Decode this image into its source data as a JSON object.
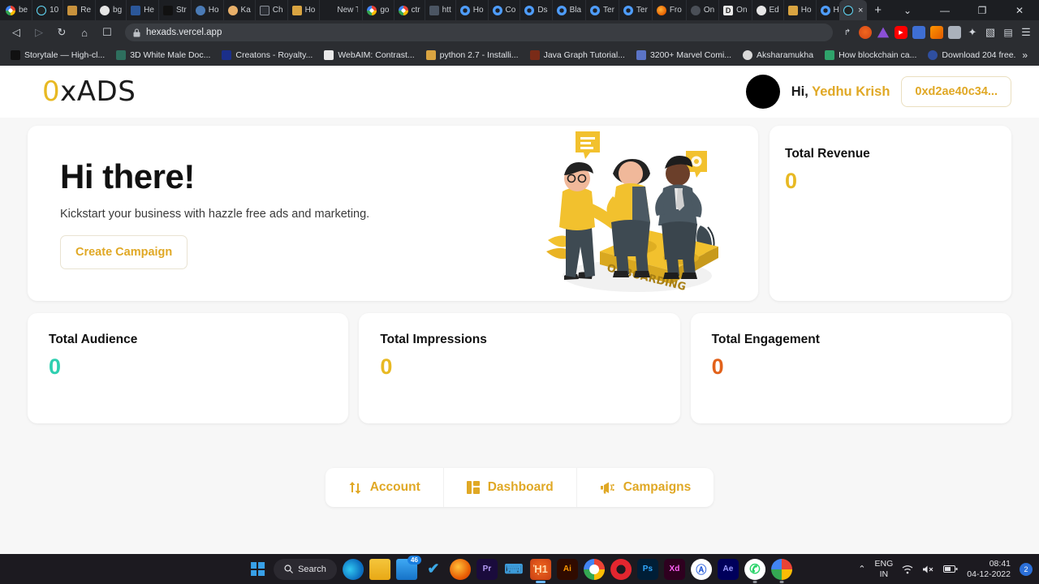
{
  "browser": {
    "tabs": [
      {
        "label": "be",
        "icon": "google-favicon",
        "fav": "g"
      },
      {
        "label": "10",
        "icon": "react-favicon",
        "fav": "react"
      },
      {
        "label": "Re",
        "icon": "book-favicon",
        "fav": "book"
      },
      {
        "label": "bg",
        "icon": "github-favicon",
        "fav": "gh"
      },
      {
        "label": "He",
        "icon": "word-favicon",
        "fav": "word"
      },
      {
        "label": "Str",
        "icon": "medium-favicon",
        "fav": "medium"
      },
      {
        "label": "Ho",
        "icon": "globe-favicon",
        "fav": "globe"
      },
      {
        "label": "Ka",
        "icon": "avatar-favicon",
        "fav": "ka"
      },
      {
        "label": "Ch",
        "icon": "box-favicon",
        "fav": "box"
      },
      {
        "label": "Ho",
        "icon": "java-favicon",
        "fav": "java"
      },
      {
        "label": "New Ta",
        "icon": "newtab-favicon",
        "fav": "newtab"
      },
      {
        "label": "go",
        "icon": "google-favicon",
        "fav": "g"
      },
      {
        "label": "ctr",
        "icon": "google-favicon",
        "fav": "g"
      },
      {
        "label": "htt",
        "icon": "hex-favicon",
        "fav": "hex"
      },
      {
        "label": "Ho",
        "icon": "circle-favicon",
        "fav": "c"
      },
      {
        "label": "Co",
        "icon": "circle-favicon",
        "fav": "c"
      },
      {
        "label": "Ds",
        "icon": "circle-favicon",
        "fav": "c"
      },
      {
        "label": "Bla",
        "icon": "circle-favicon",
        "fav": "c"
      },
      {
        "label": "Ter",
        "icon": "circle-favicon",
        "fav": "c"
      },
      {
        "label": "Ter",
        "icon": "circle-favicon",
        "fav": "c"
      },
      {
        "label": "Fro",
        "icon": "firefox-favicon",
        "fav": "firefox"
      },
      {
        "label": "On",
        "icon": "swirl-favicon",
        "fav": "sw"
      },
      {
        "label": "On",
        "icon": "docs-favicon",
        "fav": "d"
      },
      {
        "label": "Ed",
        "icon": "github-favicon",
        "fav": "gh"
      },
      {
        "label": "Ho",
        "icon": "java-favicon",
        "fav": "java"
      },
      {
        "label": "Ho",
        "icon": "circle-favicon",
        "fav": "c"
      }
    ],
    "active_tab": {
      "label": "",
      "icon": "react-favicon",
      "close_glyph": "×"
    },
    "new_tab_glyph": "+",
    "window_controls": {
      "tab_search": "⌄",
      "minimize": "—",
      "maximize": "❐",
      "close": "✕"
    },
    "nav": {
      "back": "◁",
      "forward": "▷",
      "reload": "↻",
      "home": "⌂",
      "bookmark": "☐"
    },
    "omnibox": {
      "lock": "ὑ2",
      "url": "hexads.vercel.app",
      "share": "↱"
    },
    "toolbar_icons": [
      {
        "name": "share-icon",
        "cls": "",
        "glyph": "↱"
      },
      {
        "name": "brave-shields-icon",
        "cls": "brave",
        "glyph": ""
      },
      {
        "name": "triangle-extension-icon",
        "cls": "tri",
        "glyph": ""
      },
      {
        "name": "youtube-extension-icon",
        "cls": "yt",
        "glyph": "▶"
      },
      {
        "name": "translate-extension-icon",
        "cls": "tr",
        "glyph": ""
      },
      {
        "name": "fox-extension-icon",
        "cls": "fox",
        "glyph": ""
      },
      {
        "name": "image-extension-icon",
        "cls": "img",
        "glyph": ""
      },
      {
        "name": "puzzle-extensions-icon",
        "cls": "puz",
        "glyph": "✦"
      },
      {
        "name": "sidebar-icon",
        "cls": "side",
        "glyph": "▧"
      },
      {
        "name": "wallet-icon",
        "cls": "wal",
        "glyph": "▤"
      },
      {
        "name": "browser-menu-icon",
        "cls": "menu",
        "glyph": "☰"
      }
    ],
    "bookmarks": [
      {
        "label": "Storytale — High-cl...",
        "fav": "story"
      },
      {
        "label": "3D White Male Doc...",
        "fav": "male"
      },
      {
        "label": "Creatons - Royalty...",
        "fav": "creatons"
      },
      {
        "label": "WebAIM: Contrast...",
        "fav": "webaim"
      },
      {
        "label": "python 2.7 - Installi...",
        "fav": "python"
      },
      {
        "label": "Java Graph Tutorial...",
        "fav": "javag"
      },
      {
        "label": "3200+ Marvel Comi...",
        "fav": "marvel"
      },
      {
        "label": "Aksharamukha",
        "fav": "aksh"
      },
      {
        "label": "How blockchain ca...",
        "fav": "block"
      },
      {
        "label": "Download 204 free...",
        "fav": "dl"
      }
    ],
    "bookmarks_overflow": "»"
  },
  "app": {
    "logo": {
      "prefix": "0",
      "suffix": "xADS"
    },
    "user": {
      "greeting_prefix": "Hi,",
      "name": "Yedhu Krish",
      "wallet_address": "0xd2ae40c34..."
    },
    "hero": {
      "title": "Hi there!",
      "subtitle": "Kickstart your business with hazzle free ads and marketing.",
      "cta_label": "Create Campaign",
      "illustration_caption": "ONBOARDING"
    },
    "stats": [
      {
        "label": "Total Revenue",
        "value": "0",
        "color": "#e8b923"
      },
      {
        "label": "Total Audience",
        "value": "0",
        "color": "#2ecfb0"
      },
      {
        "label": "Total Impressions",
        "value": "0",
        "color": "#e8b923"
      },
      {
        "label": "Total Engagement",
        "value": "0",
        "color": "#e2621b"
      }
    ],
    "bottom_nav": [
      {
        "label": "Account",
        "icon": "exchange-arrows-icon"
      },
      {
        "label": "Dashboard",
        "icon": "dashboard-grid-icon"
      },
      {
        "label": "Campaigns",
        "icon": "megaphone-icon"
      }
    ],
    "accent_color": "#e0a825"
  },
  "taskbar": {
    "start": "start-button",
    "search_label": "Search",
    "icons": [
      {
        "name": "edge-icon",
        "cls": "edge",
        "glyph": "",
        "badge": ""
      },
      {
        "name": "file-explorer-icon",
        "cls": "folder",
        "glyph": "",
        "badge": ""
      },
      {
        "name": "mail-icon",
        "cls": "mail",
        "glyph": "",
        "badge": "46"
      },
      {
        "name": "todo-icon",
        "cls": "todo",
        "glyph": "✔",
        "badge": ""
      },
      {
        "name": "firefox-icon",
        "cls": "ff",
        "glyph": "",
        "badge": ""
      },
      {
        "name": "premiere-pro-icon",
        "cls": "pr",
        "glyph": "Pr",
        "badge": ""
      },
      {
        "name": "vscode-icon",
        "cls": "vs",
        "glyph": "⌨",
        "badge": ""
      },
      {
        "name": "brave-icon",
        "cls": "brave",
        "glyph": "ᾘ1",
        "badge": ""
      },
      {
        "name": "illustrator-icon",
        "cls": "ai",
        "glyph": "Ai",
        "badge": ""
      },
      {
        "name": "chrome-icon",
        "cls": "chrome",
        "glyph": "",
        "badge": ""
      },
      {
        "name": "opera-icon",
        "cls": "opera",
        "glyph": "",
        "badge": ""
      },
      {
        "name": "photoshop-icon",
        "cls": "ps",
        "glyph": "Ps",
        "badge": ""
      },
      {
        "name": "adobe-xd-icon",
        "cls": "xd",
        "glyph": "Xd",
        "badge": ""
      },
      {
        "name": "acrobat-icon",
        "cls": "ac",
        "glyph": "Ⓐ",
        "badge": ""
      },
      {
        "name": "after-effects-icon",
        "cls": "ae",
        "glyph": "Ae",
        "badge": ""
      },
      {
        "name": "whatsapp-icon",
        "cls": "wa",
        "glyph": "✆",
        "badge": ""
      },
      {
        "name": "google-photos-icon",
        "cls": "gimg",
        "glyph": "",
        "badge": ""
      }
    ],
    "tray": {
      "overflow_glyph": "⌃",
      "language_line1": "ENG",
      "language_line2": "IN",
      "wifi_glyph": "◠",
      "volume_glyph": "ὐ7",
      "battery_glyph": "▰",
      "time": "08:41",
      "date": "04-12-2022",
      "notification_count": "2"
    }
  }
}
